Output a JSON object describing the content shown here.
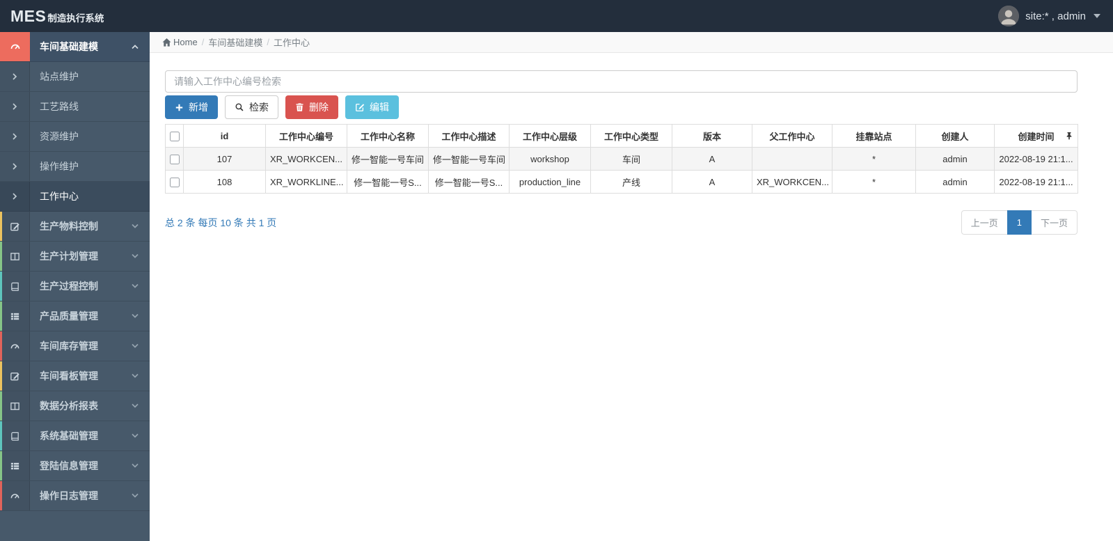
{
  "topbar": {
    "logo_primary": "MES",
    "logo_secondary": "制造执行系统",
    "user_label": "site:* , admin"
  },
  "breadcrumb": {
    "home_label": "Home",
    "separator": "/",
    "items": [
      "车间基础建模",
      "工作中心"
    ]
  },
  "sidebar": {
    "expanded": {
      "label": "车间基础建模",
      "icon": "dashboard-icon",
      "icon_bg": "#ed6c5e"
    },
    "children": [
      {
        "label": "站点维护"
      },
      {
        "label": "工艺路线"
      },
      {
        "label": "资源维护"
      },
      {
        "label": "操作维护"
      },
      {
        "label": "工作中心"
      }
    ],
    "sections": [
      {
        "label": "生产物料控制",
        "icon": "pencil-square-icon",
        "stripe": "#edc35f"
      },
      {
        "label": "生产计划管理",
        "icon": "columns-icon",
        "stripe": "#86c587"
      },
      {
        "label": "生产过程控制",
        "icon": "book-icon",
        "stripe": "#5ec5bd"
      },
      {
        "label": "产品质量管理",
        "icon": "th-list-icon",
        "stripe": "#86c587"
      },
      {
        "label": "车间库存管理",
        "icon": "dashboard-icon",
        "stripe": "#e2635b"
      },
      {
        "label": "车间看板管理",
        "icon": "pencil-square-icon",
        "stripe": "#edc35f"
      },
      {
        "label": "数据分析报表",
        "icon": "columns-icon",
        "stripe": "#86c587"
      },
      {
        "label": "系统基础管理",
        "icon": "book-icon",
        "stripe": "#5ec5bd"
      },
      {
        "label": "登陆信息管理",
        "icon": "th-list-icon",
        "stripe": "#86c587"
      },
      {
        "label": "操作日志管理",
        "icon": "dashboard-icon",
        "stripe": "#e2635b"
      }
    ]
  },
  "search": {
    "placeholder": "请输入工作中心编号检索",
    "value": ""
  },
  "toolbar": {
    "add_label": "新增",
    "search_label": "检索",
    "delete_label": "删除",
    "edit_label": "编辑"
  },
  "table": {
    "columns": [
      "id",
      "工作中心编号",
      "工作中心名称",
      "工作中心描述",
      "工作中心层级",
      "工作中心类型",
      "版本",
      "父工作中心",
      "挂靠站点",
      "创建人",
      "创建时间"
    ],
    "rows": [
      {
        "cells": [
          "107",
          "XR_WORKCEN...",
          "修一智能一号车间",
          "修一智能一号车间",
          "workshop",
          "车间",
          "A",
          "",
          "*",
          "admin",
          "2022-08-19 21:1..."
        ]
      },
      {
        "cells": [
          "108",
          "XR_WORKLINE...",
          "修一智能一号S...",
          "修一智能一号S...",
          "production_line",
          "产线",
          "A",
          "XR_WORKCEN...",
          "*",
          "admin",
          "2022-08-19 21:1..."
        ]
      }
    ]
  },
  "pagination": {
    "summary": "总 2 条 每页 10 条 共 1 页",
    "prev_label": "上一页",
    "page": "1",
    "next_label": "下一页"
  },
  "colors": {
    "primary": "#337ab7",
    "danger": "#d9534f",
    "info": "#5bc0de",
    "topbar_bg": "#232e3c",
    "sidebar_bg": "#47596a",
    "expanded_item_bg": "#3e5166",
    "active_child_bg": "#3b4c5d",
    "expanded_icon_bg": "#ed6c5e"
  },
  "icons": {
    "home-icon": "house",
    "dashboard-icon": "gauge",
    "pencil-square-icon": "pencil-square",
    "columns-icon": "columns",
    "book-icon": "book",
    "th-list-icon": "list-rows",
    "plus-icon": "plus",
    "search-icon": "magnifier",
    "trash-icon": "trash-can",
    "edit-icon": "pencil-square",
    "caret-down-icon": "caret-down",
    "chevron-up-icon": "chevron-up",
    "chevron-down-icon": "chevron-down",
    "chevron-right-icon": "chevron-right",
    "pin-icon": "pushpin",
    "avatar": "user-photo"
  }
}
